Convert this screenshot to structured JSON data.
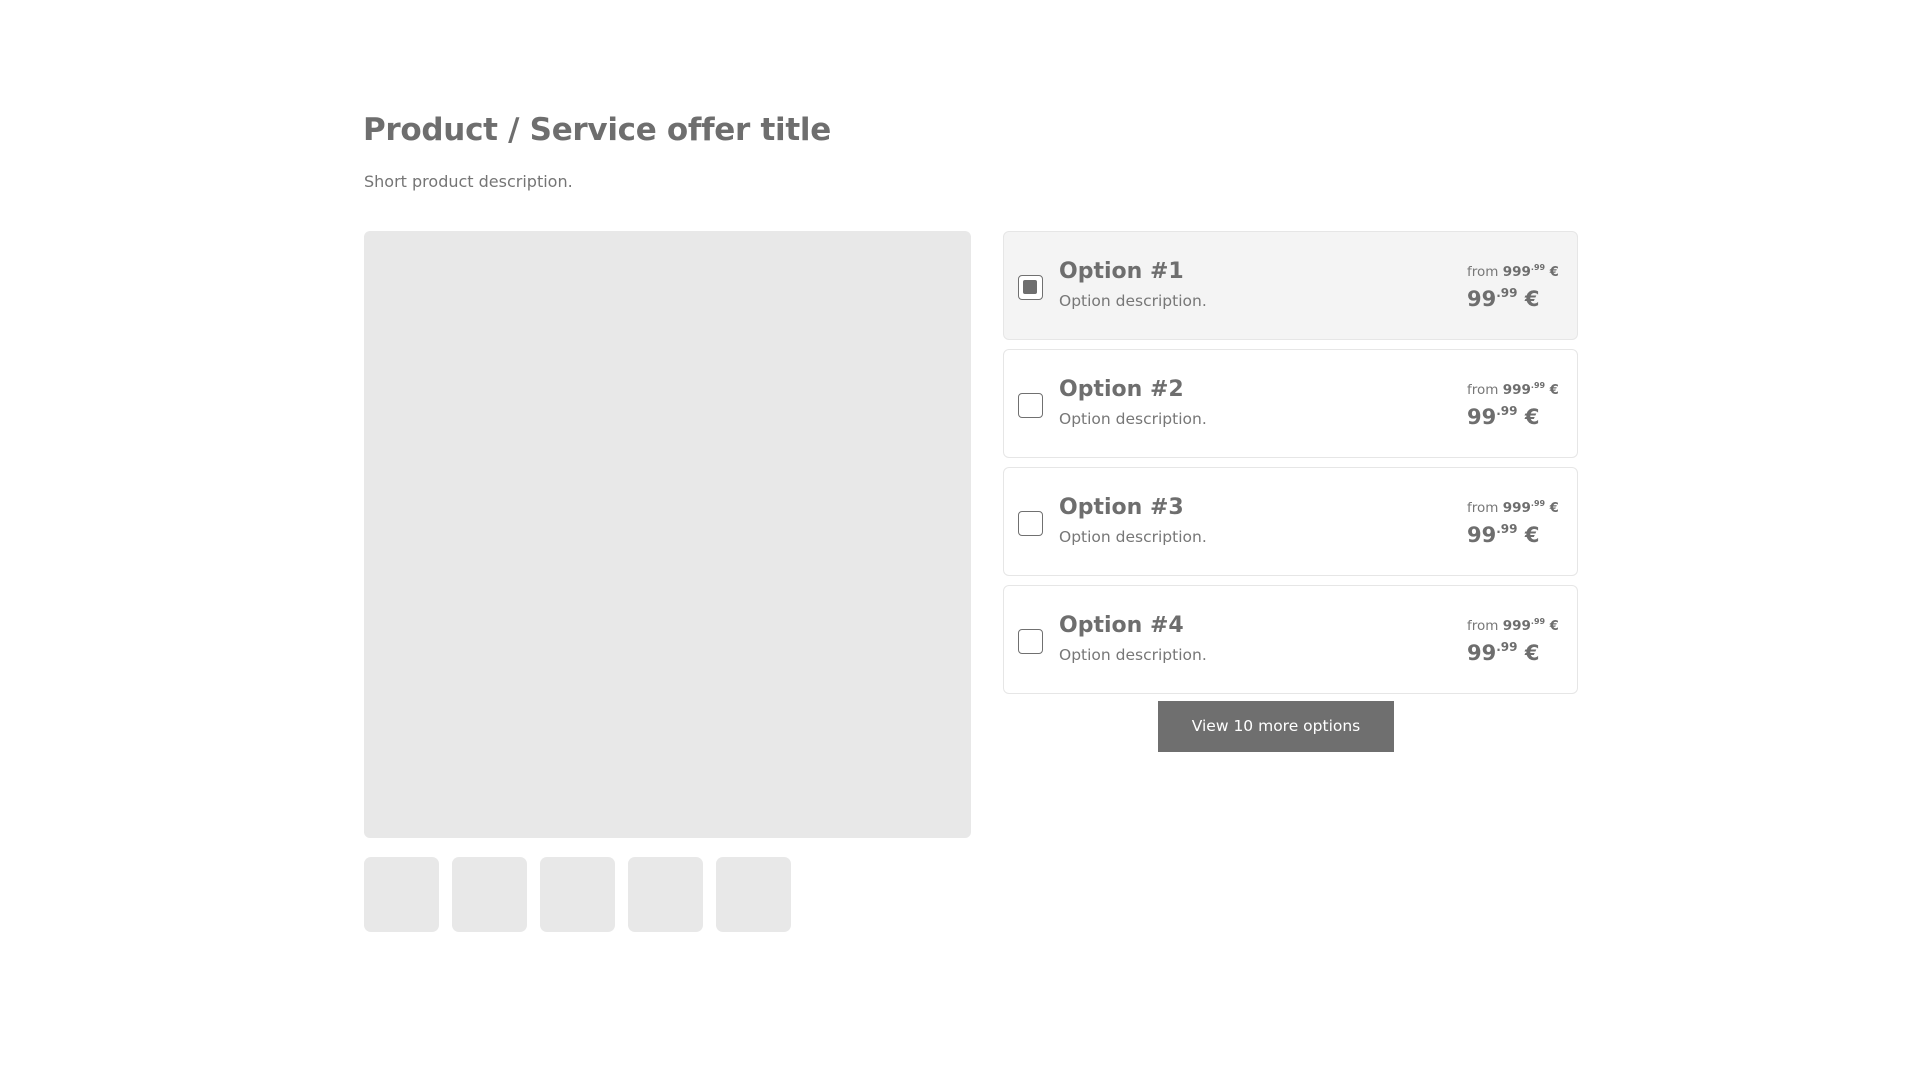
{
  "header": {
    "title": "Product / Service offer title",
    "description": "Short product description."
  },
  "gallery": {
    "main_image": "image-placeholder",
    "thumbnails": [
      "thumbnail-1",
      "thumbnail-2",
      "thumbnail-3",
      "thumbnail-4",
      "thumbnail-5"
    ]
  },
  "options": [
    {
      "title": "Option #1",
      "description": "Option description.",
      "selected": true,
      "from_label": "from",
      "from_int": "999",
      "from_dec": ".99",
      "from_currency": "€",
      "price_int": "99",
      "price_dec": ".99",
      "price_currency": "€"
    },
    {
      "title": "Option #2",
      "description": "Option description.",
      "selected": false,
      "from_label": "from",
      "from_int": "999",
      "from_dec": ".99",
      "from_currency": "€",
      "price_int": "99",
      "price_dec": ".99",
      "price_currency": "€"
    },
    {
      "title": "Option #3",
      "description": "Option description.",
      "selected": false,
      "from_label": "from",
      "from_int": "999",
      "from_dec": ".99",
      "from_currency": "€",
      "price_int": "99",
      "price_dec": ".99",
      "price_currency": "€"
    },
    {
      "title": "Option #4",
      "description": "Option description.",
      "selected": false,
      "from_label": "from",
      "from_int": "999",
      "from_dec": ".99",
      "from_currency": "€",
      "price_int": "99",
      "price_dec": ".99",
      "price_currency": "€"
    }
  ],
  "more_button": {
    "label": "View 10 more options"
  },
  "colors": {
    "text": "#6e6e6e",
    "placeholder": "#e8e8e8",
    "selected_bg": "#f4f4f4",
    "border": "#e6e6e6",
    "button_bg": "#6f6f6f",
    "button_text": "#ffffff"
  }
}
